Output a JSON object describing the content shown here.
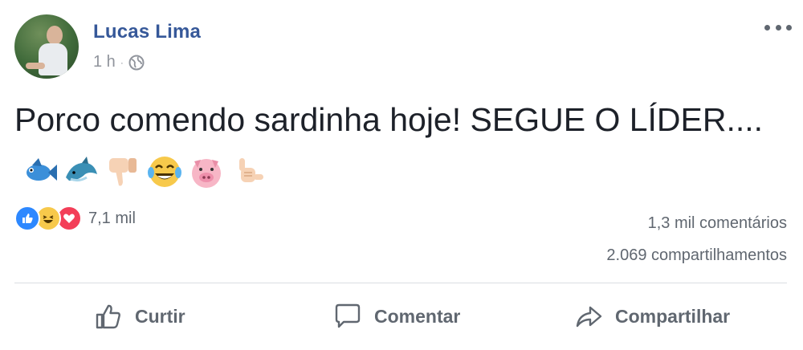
{
  "post": {
    "author": "Lucas Lima",
    "time": "1 h",
    "separator": "·",
    "privacy_icon": "globe-icon",
    "more_icon": "more-options-icon",
    "text": "Porco comendo sardinha hoje! SEGUE O LÍDER....",
    "emojis": [
      "fish-emoji",
      "dolphin-emoji",
      "thumbs-down-emoji",
      "tears-of-joy-emoji",
      "pig-emoji",
      "call-me-hand-emoji"
    ]
  },
  "reactions": {
    "icons": [
      "like-reaction-icon",
      "haha-reaction-icon",
      "love-reaction-icon"
    ],
    "count": "7,1 mil"
  },
  "stats": {
    "comments": "1,3 mil comentários",
    "shares": "2.069 compartilhamentos"
  },
  "actions": {
    "like": "Curtir",
    "comment": "Comentar",
    "share": "Compartilhar"
  },
  "colors": {
    "author": "#365899",
    "like_blue": "#2d88ff",
    "love_red": "#f33e58",
    "haha_yellow": "#f7c94b",
    "muted_text": "#606770"
  }
}
